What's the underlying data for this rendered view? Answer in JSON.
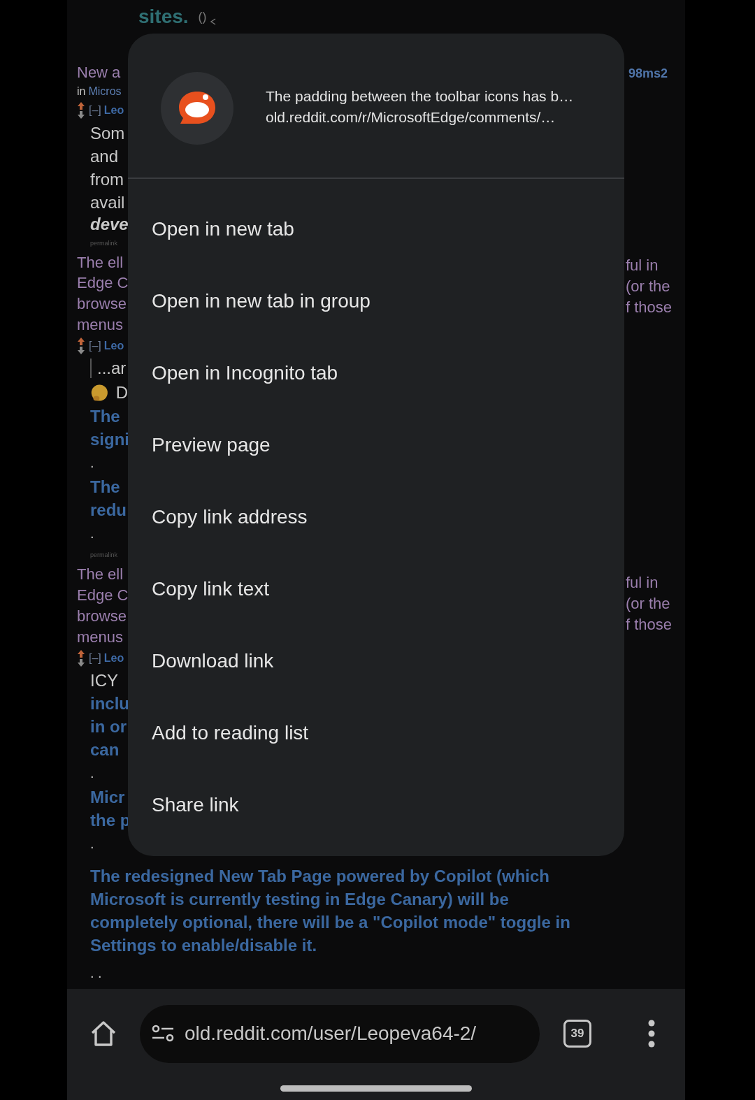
{
  "background_page": {
    "top": {
      "text": "sites.",
      "score": "()"
    },
    "left_fragments": [
      {
        "kind": "title",
        "text": "New a"
      },
      {
        "kind": "subreddit",
        "prefix": "in",
        "text": "Micros"
      },
      {
        "kind": "author",
        "toggle": "[–]",
        "text": "Leo"
      },
      {
        "kind": "body",
        "text": "Som"
      },
      {
        "kind": "body",
        "text": "and"
      },
      {
        "kind": "body",
        "text": "from"
      },
      {
        "kind": "body",
        "text": "avail"
      },
      {
        "kind": "emphasis",
        "text": "deve"
      },
      {
        "kind": "permalink",
        "text": "permalink"
      },
      {
        "kind": "title",
        "text": "The ell"
      },
      {
        "kind": "title",
        "text": "Edge C"
      },
      {
        "kind": "title",
        "text": "browse"
      },
      {
        "kind": "title",
        "text": "menus"
      },
      {
        "kind": "author",
        "toggle": "[–]",
        "text": "Leo"
      },
      {
        "kind": "quote",
        "text": "...ar"
      },
      {
        "kind": "emoji",
        "text": "D"
      },
      {
        "kind": "link",
        "text": "The"
      },
      {
        "kind": "link",
        "text": "signi"
      },
      {
        "kind": "dot",
        "text": "."
      },
      {
        "kind": "link",
        "text": "The"
      },
      {
        "kind": "link",
        "text": "redu"
      },
      {
        "kind": "dot",
        "text": "."
      },
      {
        "kind": "permalink",
        "text": "permalink"
      },
      {
        "kind": "title",
        "text": "The ell"
      },
      {
        "kind": "title",
        "text": "Edge C"
      },
      {
        "kind": "title",
        "text": "browse"
      },
      {
        "kind": "title",
        "text": "menus"
      },
      {
        "kind": "author",
        "toggle": "[–]",
        "text": "Leo"
      },
      {
        "kind": "body",
        "text": "ICY"
      },
      {
        "kind": "link",
        "text": "inclu"
      },
      {
        "kind": "link",
        "text": "in or"
      },
      {
        "kind": "link",
        "text": "can"
      },
      {
        "kind": "dot",
        "text": "."
      },
      {
        "kind": "link",
        "text": "Micr"
      },
      {
        "kind": "link",
        "text": "the p"
      },
      {
        "kind": "dot",
        "text": "."
      }
    ],
    "right_fragments": [
      {
        "kind": "user",
        "lines": [
          "98ms2"
        ]
      },
      {
        "kind": "title",
        "lines": [
          "ful in",
          "(or the",
          "f those"
        ]
      },
      {
        "kind": "title",
        "lines": [
          "ful in",
          "(or the",
          "f those"
        ]
      }
    ],
    "paragraph": "The redesigned New Tab Page powered by Copilot (which Microsoft is currently testing in Edge Canary) will be completely optional, there will be a \"Copilot mode\" toggle in Settings to enable/disable it.",
    "trailing": ". ."
  },
  "context_menu": {
    "title": "The padding between the toolbar icons has b…",
    "url": "old.reddit.com/r/MicrosoftEdge/comments/…",
    "items": [
      "Open in new tab",
      "Open in new tab in group",
      "Open in Incognito tab",
      "Preview page",
      "Copy link address",
      "Copy link text",
      "Download link",
      "Add to reading list",
      "Share link"
    ]
  },
  "toolbar": {
    "url": "old.reddit.com/user/Leopeva64-2/",
    "tab_count": "39"
  }
}
